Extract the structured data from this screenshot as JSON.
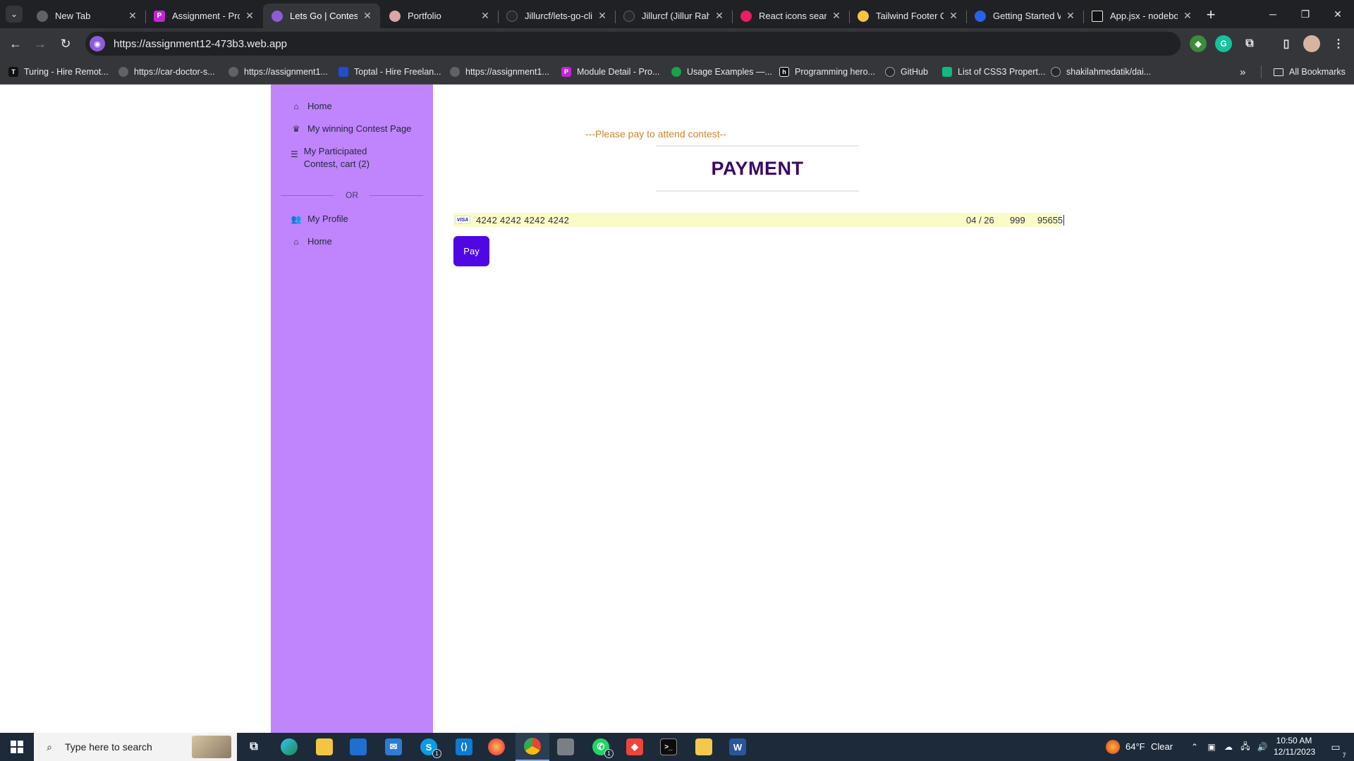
{
  "browser": {
    "tabs": [
      {
        "title": "New Tab",
        "fav_color": "#5f6368",
        "fav_glyph": ""
      },
      {
        "title": "Assignment - Pro",
        "fav_color": "#c026d3",
        "fav_glyph": "P"
      },
      {
        "title": "Lets Go | Contest",
        "fav_color": "#8e5cd9",
        "fav_glyph": ""
      },
      {
        "title": "Portfolio",
        "fav_color": "#d9a5a5",
        "fav_glyph": ""
      },
      {
        "title": "Jillurcf/lets-go-clie",
        "fav_color": "#24292f",
        "fav_glyph": ""
      },
      {
        "title": "Jillurcf (Jillur Rahm",
        "fav_color": "#24292f",
        "fav_glyph": ""
      },
      {
        "title": "React icons search",
        "fav_color": "#e91e63",
        "fav_glyph": ""
      },
      {
        "title": "Tailwind Footer Co",
        "fav_color": "#f6c343",
        "fav_glyph": ""
      },
      {
        "title": "Getting Started W",
        "fav_color": "#2563eb",
        "fav_glyph": ""
      },
      {
        "title": "App.jsx - nodebox",
        "fav_color": "#111111",
        "fav_glyph": ""
      }
    ],
    "new_tab_glyph": "+",
    "url": "https://assignment12-473b3.web.app",
    "bookmarks": [
      {
        "label": "Turing - Hire Remot...",
        "fav_color": "#111111",
        "fav_glyph": "T"
      },
      {
        "label": "https://car-doctor-s...",
        "fav_color": "#5f6368",
        "fav_glyph": ""
      },
      {
        "label": "https://assignment1...",
        "fav_color": "#5f6368",
        "fav_glyph": ""
      },
      {
        "label": "Toptal - Hire Freelan...",
        "fav_color": "#204ecf",
        "fav_glyph": ""
      },
      {
        "label": "https://assignment1...",
        "fav_color": "#5f6368",
        "fav_glyph": ""
      },
      {
        "label": "Module Detail - Pro...",
        "fav_color": "#c026d3",
        "fav_glyph": "P"
      },
      {
        "label": "Usage Examples —...",
        "fav_color": "#16a34a",
        "fav_glyph": ""
      },
      {
        "label": "Programming hero...",
        "fav_color": "#111111",
        "fav_glyph": "h"
      },
      {
        "label": "GitHub",
        "fav_color": "#24292f",
        "fav_glyph": ""
      },
      {
        "label": "List of CSS3 Propert...",
        "fav_color": "#10b981",
        "fav_glyph": ""
      },
      {
        "label": "shakilahmedatik/dai...",
        "fav_color": "#24292f",
        "fav_glyph": ""
      }
    ],
    "all_bookmarks_label": "All Bookmarks",
    "overflow_glyph": "»"
  },
  "sidebar": {
    "items_top": [
      {
        "label": "Home",
        "icon": "home-icon"
      },
      {
        "label": "My winning Contest Page",
        "icon": "trophy-icon"
      },
      {
        "label": "My Participated Contest, cart (2)",
        "icon": "list-icon"
      }
    ],
    "divider_label": "OR",
    "items_bottom": [
      {
        "label": "My Profile",
        "icon": "users-icon"
      },
      {
        "label": "Home",
        "icon": "home-icon"
      }
    ]
  },
  "main": {
    "subtitle": "---Please pay to attend contest--",
    "title": "PAYMENT",
    "card": {
      "brand": "VISA",
      "number": "4242 4242 4242 4242",
      "expiry": "04 / 26",
      "cvc": "999",
      "zip": "95655"
    },
    "pay_label": "Pay"
  },
  "taskbar": {
    "search_placeholder": "Type here to search",
    "weather_temp": "64°F",
    "weather_desc": "Clear",
    "time": "10:50 AM",
    "date": "12/11/2023",
    "notification_count": "7",
    "skype_badge": "1",
    "whatsapp_badge": "1"
  },
  "colors": {
    "sidebar_bg": "#c084fc",
    "title": "#3b0764",
    "subtitle": "#c8862b",
    "pay_button": "#4f08e4",
    "card_autofill_bg": "#fafcc7"
  }
}
